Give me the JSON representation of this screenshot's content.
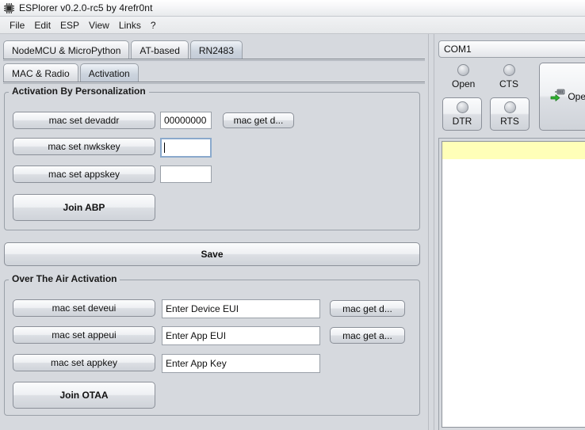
{
  "window": {
    "title": "ESPlorer v0.2.0-rc5 by 4refr0nt",
    "icon": "chip-icon"
  },
  "menubar": {
    "items": [
      {
        "label": "File"
      },
      {
        "label": "Edit"
      },
      {
        "label": "ESP"
      },
      {
        "label": "View"
      },
      {
        "label": "Links"
      },
      {
        "label": "?"
      }
    ]
  },
  "tabs_outer": {
    "items": [
      {
        "label": "NodeMCU & MicroPython",
        "selected": false
      },
      {
        "label": "AT-based",
        "selected": false
      },
      {
        "label": "RN2483",
        "selected": true
      }
    ]
  },
  "tabs_inner": {
    "items": [
      {
        "label": "MAC & Radio",
        "selected": false
      },
      {
        "label": "Activation",
        "selected": true
      }
    ]
  },
  "abp": {
    "title": "Activation By Personalization",
    "rows": [
      {
        "set_button": "mac set devaddr",
        "value": "00000000",
        "placeholder": "",
        "focused": false,
        "get_button": "mac get d..."
      },
      {
        "set_button": "mac set nwkskey",
        "value": "",
        "placeholder": "",
        "focused": true,
        "get_button": ""
      },
      {
        "set_button": "mac set appskey",
        "value": "",
        "placeholder": "",
        "focused": false,
        "get_button": ""
      }
    ],
    "join_button": "Join ABP"
  },
  "save": {
    "label": "Save"
  },
  "otaa": {
    "title": "Over The Air Activation",
    "rows": [
      {
        "set_button": "mac set deveui",
        "value": "Enter Device EUI",
        "get_button": "mac get d..."
      },
      {
        "set_button": "mac set appeui",
        "value": "Enter App EUI",
        "get_button": "mac get a..."
      },
      {
        "set_button": "mac set appkey",
        "value": "Enter App Key",
        "get_button": ""
      }
    ],
    "join_button": "Join OTAA"
  },
  "serial": {
    "port_selected": "COM1",
    "leds": [
      {
        "label": "Open",
        "state": "off"
      },
      {
        "label": "CTS",
        "state": "off"
      }
    ],
    "toggles": [
      {
        "label": "DTR",
        "state": "off"
      },
      {
        "label": "RTS",
        "state": "off"
      }
    ],
    "open_button": {
      "label": "Open",
      "icon": "green-arrow-plug-icon"
    }
  },
  "console": {
    "highlight_line": "",
    "lines": []
  },
  "colors": {
    "panel_bg": "#d6d9de",
    "tab_selected": "#c8d0db",
    "field_bg": "#ffffff",
    "focus_border": "#8aa9cc",
    "console_highlight": "#ffffb8",
    "arrow_green": "#2fb230"
  }
}
